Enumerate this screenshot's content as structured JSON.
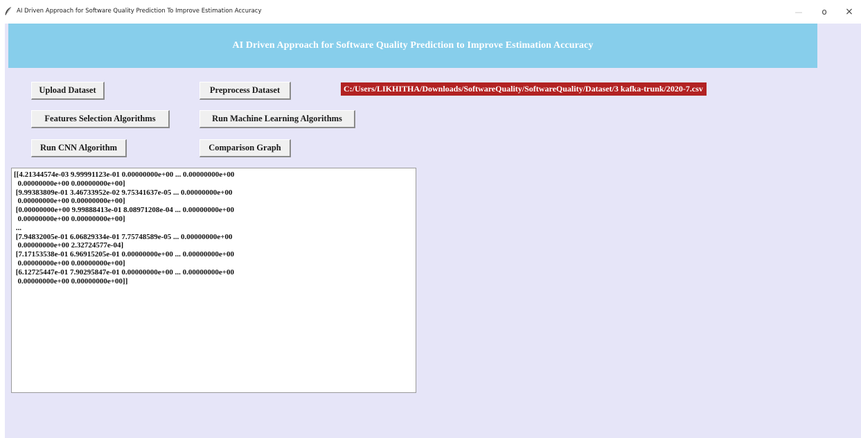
{
  "window": {
    "title": "AI Driven Approach for Software Quality Prediction To Improve Estimation Accuracy",
    "icon": "feather-icon",
    "controls": {
      "minimize": "—",
      "maximize": "o",
      "close": "×"
    }
  },
  "banner": {
    "title": "AI Driven Approach for Software Quality Prediction to Improve Estimation Accuracy",
    "background": "#87ceeb",
    "text_color": "#ffffff"
  },
  "buttons": {
    "upload_dataset": "Upload Dataset",
    "preprocess_dataset": "Preprocess Dataset",
    "features_selection": "Features Selection Algorithms",
    "run_ml": "Run Machine Learning Algorithms",
    "run_cnn": "Run CNN Algorithm",
    "comparison_graph": "Comparison Graph"
  },
  "dataset_path": {
    "text": "C:/Users/LIKHITHA/Downloads/SoftwareQuality/SoftwareQuality/Dataset/3 kafka-trunk/2020-7.csv",
    "background": "#b22222",
    "text_color": "#ffffff"
  },
  "output": {
    "text": "[[4.21344574e-03 9.99991123e-01 0.00000000e+00 ... 0.00000000e+00\n  0.00000000e+00 0.00000000e+00]\n [9.99383809e-01 3.46733952e-02 9.75341637e-05 ... 0.00000000e+00\n  0.00000000e+00 0.00000000e+00]\n [0.00000000e+00 9.99888413e-01 8.08971208e-04 ... 0.00000000e+00\n  0.00000000e+00 0.00000000e+00]\n ...\n [7.94832005e-01 6.06829334e-01 7.75748589e-05 ... 0.00000000e+00\n  0.00000000e+00 2.32724577e-04]\n [7.17153538e-01 6.96915205e-01 0.00000000e+00 ... 0.00000000e+00\n  0.00000000e+00 0.00000000e+00]\n [6.12725447e-01 7.90295847e-01 0.00000000e+00 ... 0.00000000e+00\n  0.00000000e+00 0.00000000e+00]]"
  },
  "colors": {
    "client_background": "#e6e5f8",
    "button_face": "#f0f0f0"
  }
}
